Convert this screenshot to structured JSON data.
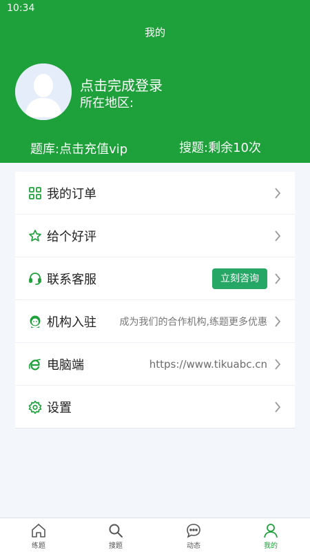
{
  "status": {
    "time": "10:34"
  },
  "header": {
    "title": "我的",
    "login_prompt": "点击完成登录",
    "region_label": "所在地区:",
    "question_bank": "题库:点击充值vip",
    "search_remaining": "搜题:剩余10次"
  },
  "menu": {
    "items": [
      {
        "label": "我的订单",
        "icon": "grid-icon"
      },
      {
        "label": "给个好评",
        "icon": "star-icon"
      },
      {
        "label": "联系客服",
        "icon": "headset-icon",
        "button": "立刻咨询"
      },
      {
        "label": "机构入驻",
        "icon": "agent-icon",
        "extra": "成为我们的合作机构,练题更多优惠"
      },
      {
        "label": "电脑端",
        "icon": "ie-icon",
        "extra": "https://www.tikuabc.cn"
      },
      {
        "label": "设置",
        "icon": "settings-icon"
      }
    ]
  },
  "tabbar": {
    "tabs": [
      {
        "label": "练题",
        "icon": "home-icon"
      },
      {
        "label": "搜题",
        "icon": "search-icon"
      },
      {
        "label": "动态",
        "icon": "chat-icon"
      },
      {
        "label": "我的",
        "icon": "user-icon",
        "active": true
      }
    ]
  },
  "colors": {
    "brand_green": "#1ea03a",
    "button_green": "#26a765",
    "page_bg": "#f3f6fb"
  }
}
